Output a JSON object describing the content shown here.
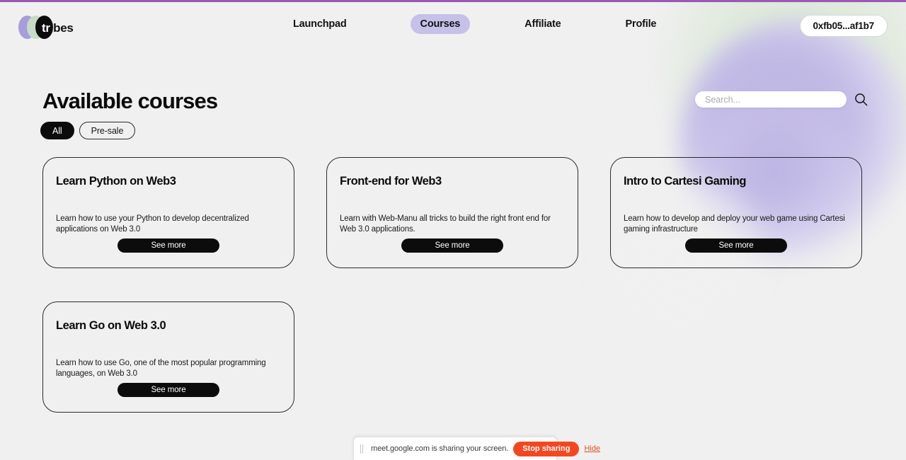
{
  "header": {
    "brand": {
      "name": "tribes",
      "name_prefix": "tr",
      "name_suffix": "ibes"
    },
    "nav": [
      {
        "label": "Launchpad",
        "active": false
      },
      {
        "label": "Courses",
        "active": true
      },
      {
        "label": "Affiliate",
        "active": false
      },
      {
        "label": "Profile",
        "active": false
      }
    ],
    "wallet": {
      "label": "0xfb05...af1b7"
    }
  },
  "main": {
    "title": "Available courses",
    "filters": [
      {
        "label": "All",
        "active": true
      },
      {
        "label": "Pre-sale",
        "active": false
      }
    ],
    "search": {
      "value": "",
      "placeholder": "Search...",
      "icon": "search-icon"
    },
    "courses": [
      {
        "title": "Learn Python on Web3",
        "description": "Learn how to use your Python to develop decentralized applications on Web 3.0",
        "button": "See more"
      },
      {
        "title": "Front-end for Web3",
        "description": "Learn with Web-Manu all tricks to build the right front end for Web 3.0 applications.",
        "button": "See more"
      },
      {
        "title": "Intro to Cartesi Gaming",
        "description": "Learn how to develop and deploy your web game using Cartesi gaming infrastructure",
        "button": "See more"
      },
      {
        "title": "Learn Go on Web 3.0",
        "description": "Learn how to use Go, one of the most popular programming languages, on Web 3.0",
        "button": "See more"
      }
    ]
  },
  "screen_share_bar": {
    "message": "meet.google.com is sharing your screen.",
    "stop_label": "Stop sharing",
    "hide_label": "Hide"
  },
  "colors": {
    "background": "#f0f0f0",
    "accent_purple": "#c5c1e8",
    "blob_green": "#dbe7d6",
    "blob_purple": "#b9b0e2",
    "button_dark": "#0c0c0c",
    "share_orange": "#f4471f",
    "top_border_purple": "#9b59b6"
  }
}
